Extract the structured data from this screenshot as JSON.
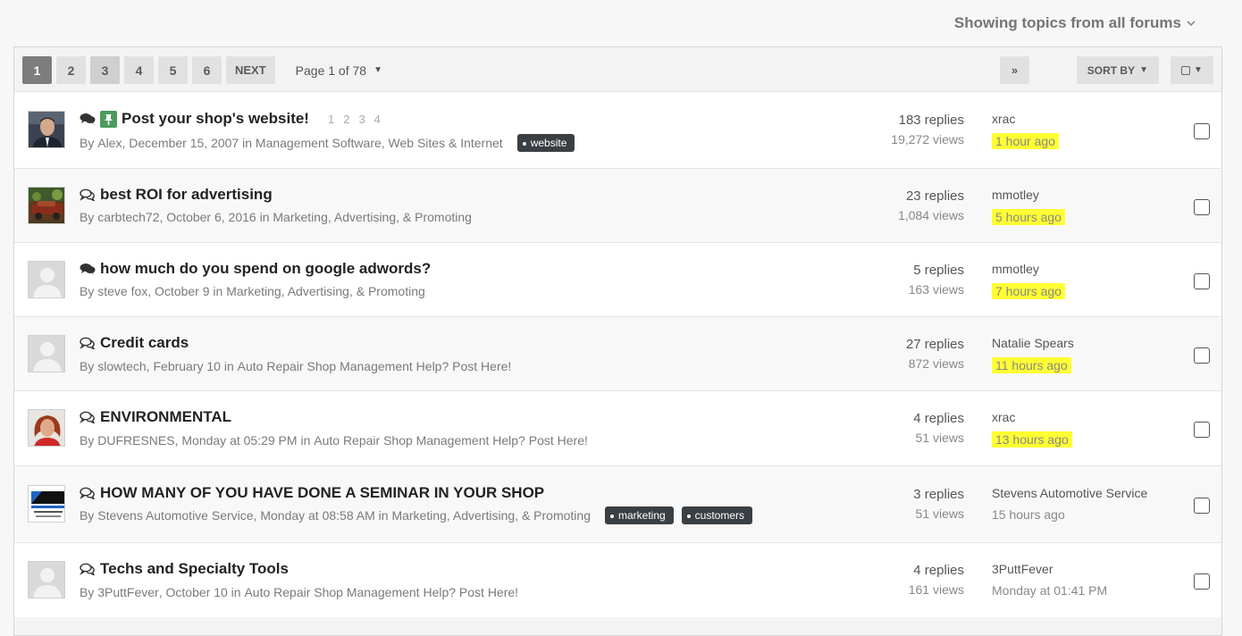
{
  "filter": {
    "label": "Showing topics from all forums",
    "icon": "chevron-down-icon"
  },
  "pagination": {
    "pages": [
      "1",
      "2",
      "3",
      "4",
      "5",
      "6"
    ],
    "active": "1",
    "next_label": "NEXT",
    "last_label": "»",
    "page_info": "Page 1 of 78"
  },
  "sort_label": "SORT BY",
  "topics": [
    {
      "title": "Post your shop's website!",
      "pinned": true,
      "icon": "comments-filled-icon",
      "mini_pages": [
        "1",
        "2",
        "3",
        "4"
      ],
      "author": "Alex",
      "date": "December 15, 2007",
      "in": " in ",
      "forum": "Management Software, Web Sites & Internet",
      "tags": [
        "website"
      ],
      "replies": "183 replies",
      "views": "19,272 views",
      "last_user": "xrac",
      "last_time": "1 hour ago",
      "highlight": true,
      "avatar": "photo-man"
    },
    {
      "title": "best ROI for advertising",
      "icon": "comments-outline-icon",
      "author": "carbtech72",
      "date": "October 6, 2016",
      "in": " in ",
      "forum": "Marketing, Advertising, & Promoting",
      "tags": [],
      "replies": "23 replies",
      "views": "1,084 views",
      "last_user": "mmotley",
      "last_time": "5 hours ago",
      "highlight": true,
      "avatar": "photo-car"
    },
    {
      "title": "how much do you spend on google adwords?",
      "icon": "comments-filled-icon",
      "author": "steve fox",
      "date": "October 9",
      "in": " in ",
      "forum": "Marketing, Advertising, & Promoting",
      "tags": [],
      "replies": "5 replies",
      "views": "163 views",
      "last_user": "mmotley",
      "last_time": "7 hours ago",
      "highlight": true,
      "avatar": "default"
    },
    {
      "title": "Credit cards",
      "icon": "comments-outline-icon",
      "author": "slowtech",
      "date": "February 10",
      "in": " in ",
      "forum": "Auto Repair Shop Management Help? Post Here!",
      "tags": [],
      "replies": "27 replies",
      "views": "872 views",
      "last_user": "Natalie Spears",
      "last_time": "11 hours ago",
      "highlight": true,
      "avatar": "default"
    },
    {
      "title": "ENVIRONMENTAL",
      "icon": "comments-outline-icon",
      "author": "DUFRESNES",
      "date": "Monday at 05:29 PM",
      "in": " in ",
      "forum": "Auto Repair Shop Management Help? Post Here!",
      "tags": [],
      "replies": "4 replies",
      "views": "51 views",
      "last_user": "xrac",
      "last_time": "13 hours ago",
      "highlight": true,
      "avatar": "photo-woman"
    },
    {
      "title": "HOW MANY OF YOU HAVE DONE A SEMINAR IN YOUR SHOP",
      "icon": "comments-outline-icon",
      "author": "Stevens Automotive Service",
      "date": "Monday at 08:58 AM",
      "in": " in ",
      "forum": "Marketing, Advertising, & Promoting",
      "tags": [
        "marketing",
        "customers"
      ],
      "replies": "3 replies",
      "views": "51 views",
      "last_user": "Stevens Automotive Service",
      "last_time": "15 hours ago",
      "highlight": false,
      "avatar": "logo-stevens"
    },
    {
      "title": "Techs and Specialty Tools",
      "icon": "comments-outline-icon",
      "author": "3PuttFever",
      "date": "October 10",
      "in": " in ",
      "forum": "Auto Repair Shop Management Help? Post Here!",
      "tags": [],
      "replies": "4 replies",
      "views": "161 views",
      "last_user": "3PuttFever",
      "last_time": "Monday at 01:41 PM",
      "highlight": false,
      "avatar": "default"
    }
  ]
}
